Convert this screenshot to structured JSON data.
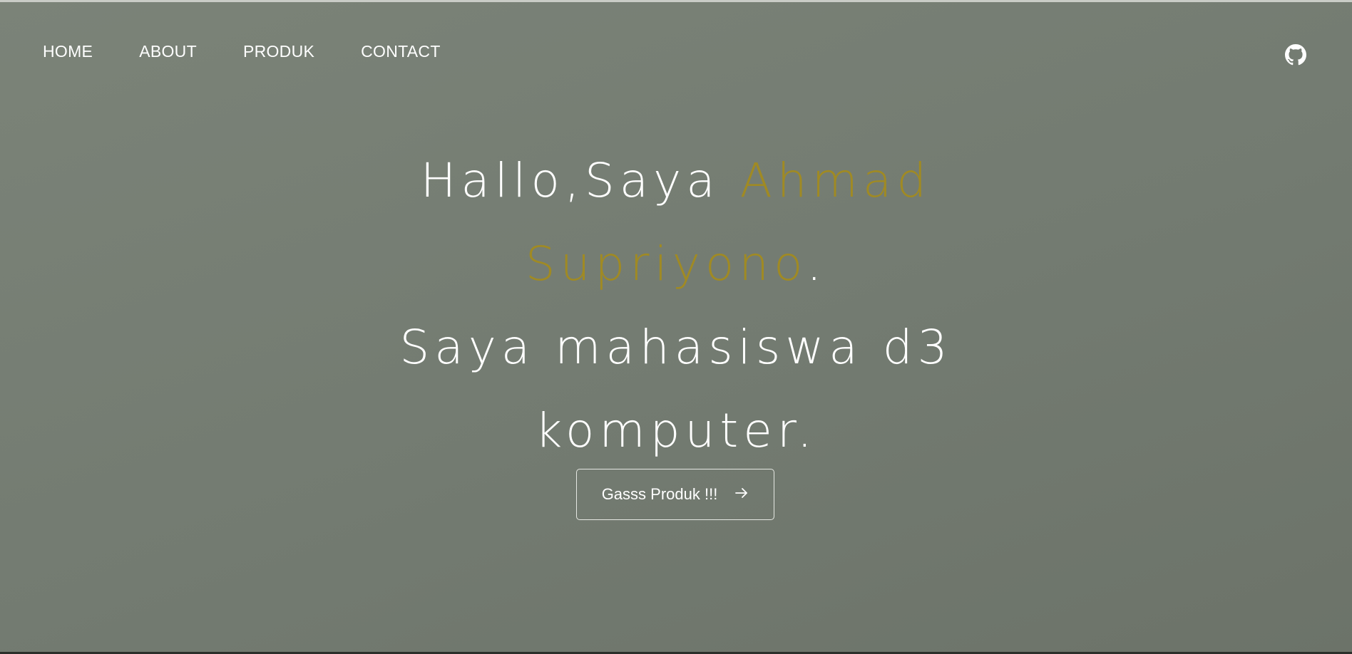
{
  "nav": {
    "items": [
      {
        "label": "HOME"
      },
      {
        "label": "ABOUT"
      },
      {
        "label": "PRODUK"
      },
      {
        "label": "CONTACT"
      }
    ]
  },
  "header_icons": {
    "github": "github-icon"
  },
  "hero": {
    "greeting": "Hallo,Saya ",
    "name_first": "Ahmad",
    "name_last": "Supriyono",
    "name_period": ".",
    "tagline_1": "Saya mahasiswa d3",
    "tagline_2": "komputer.",
    "cta_label": "Gasss Produk !!!",
    "cta_icon": "arrow-right-icon"
  },
  "colors": {
    "background": "#777f75",
    "accent": "#a08a23",
    "text": "#ffffff"
  }
}
